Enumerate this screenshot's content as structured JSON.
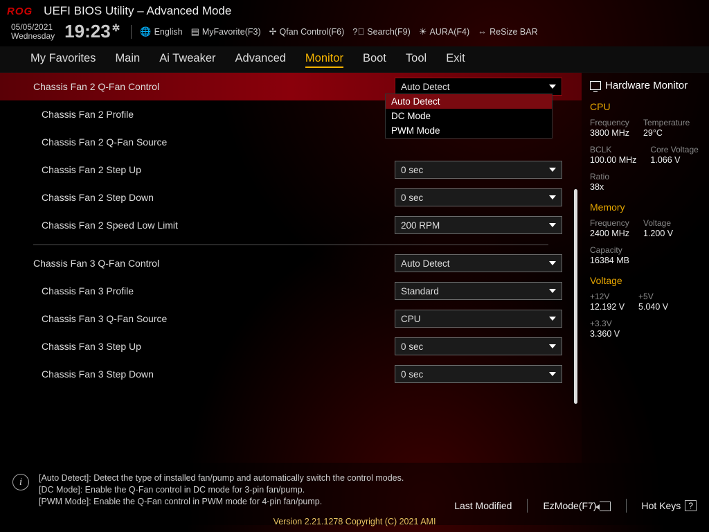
{
  "header": {
    "title": "UEFI BIOS Utility – Advanced Mode",
    "date": "05/05/2021",
    "day": "Wednesday",
    "time": "19:23"
  },
  "toolbar": {
    "language": "English",
    "myfav": "MyFavorite(F3)",
    "qfan": "Qfan Control(F6)",
    "search": "Search(F9)",
    "aura": "AURA(F4)",
    "resize": "ReSize BAR"
  },
  "tabs": [
    "My Favorites",
    "Main",
    "Ai Tweaker",
    "Advanced",
    "Monitor",
    "Boot",
    "Tool",
    "Exit"
  ],
  "active_tab": "Monitor",
  "rows": [
    {
      "label": "Chassis Fan 2 Q-Fan Control",
      "value": "Auto Detect",
      "hl": true,
      "indent": false,
      "open": true,
      "options": [
        "Auto Detect",
        "DC Mode",
        "PWM Mode"
      ]
    },
    {
      "label": "Chassis Fan 2 Profile",
      "value": "",
      "indent": true
    },
    {
      "label": "Chassis Fan 2 Q-Fan Source",
      "value": "",
      "indent": true
    },
    {
      "label": "Chassis Fan 2 Step Up",
      "value": "0 sec",
      "indent": true
    },
    {
      "label": "Chassis Fan 2 Step Down",
      "value": "0 sec",
      "indent": true
    },
    {
      "label": "Chassis Fan 2 Speed Low Limit",
      "value": "200 RPM",
      "indent": true
    },
    {
      "divider": true
    },
    {
      "label": "Chassis Fan 3 Q-Fan Control",
      "value": "Auto Detect",
      "indent": false
    },
    {
      "label": "Chassis Fan 3 Profile",
      "value": "Standard",
      "indent": true
    },
    {
      "label": "Chassis Fan 3 Q-Fan Source",
      "value": "CPU",
      "indent": true
    },
    {
      "label": "Chassis Fan 3 Step Up",
      "value": "0 sec",
      "indent": true
    },
    {
      "label": "Chassis Fan 3 Step Down",
      "value": "0 sec",
      "indent": true
    }
  ],
  "help": {
    "l1": "[Auto Detect]: Detect the type of installed fan/pump and automatically switch the control modes.",
    "l2": "[DC Mode]: Enable the Q-Fan control in DC mode for 3-pin fan/pump.",
    "l3": "[PWM Mode]: Enable the Q-Fan control in PWM mode for 4-pin fan/pump."
  },
  "hw": {
    "title": "Hardware Monitor",
    "cpu": {
      "title": "CPU",
      "freq_k": "Frequency",
      "freq_v": "3800 MHz",
      "temp_k": "Temperature",
      "temp_v": "29°C",
      "bclk_k": "BCLK",
      "bclk_v": "100.00 MHz",
      "cv_k": "Core Voltage",
      "cv_v": "1.066 V",
      "ratio_k": "Ratio",
      "ratio_v": "38x"
    },
    "mem": {
      "title": "Memory",
      "freq_k": "Frequency",
      "freq_v": "2400 MHz",
      "volt_k": "Voltage",
      "volt_v": "1.200 V",
      "cap_k": "Capacity",
      "cap_v": "16384 MB"
    },
    "volt": {
      "title": "Voltage",
      "v12_k": "+12V",
      "v12_v": "12.192 V",
      "v5_k": "+5V",
      "v5_v": "5.040 V",
      "v33_k": "+3.3V",
      "v33_v": "3.360 V"
    }
  },
  "footer": {
    "last": "Last Modified",
    "ez": "EzMode(F7)",
    "hot": "Hot Keys",
    "copy": "Version 2.21.1278 Copyright (C) 2021 AMI"
  }
}
